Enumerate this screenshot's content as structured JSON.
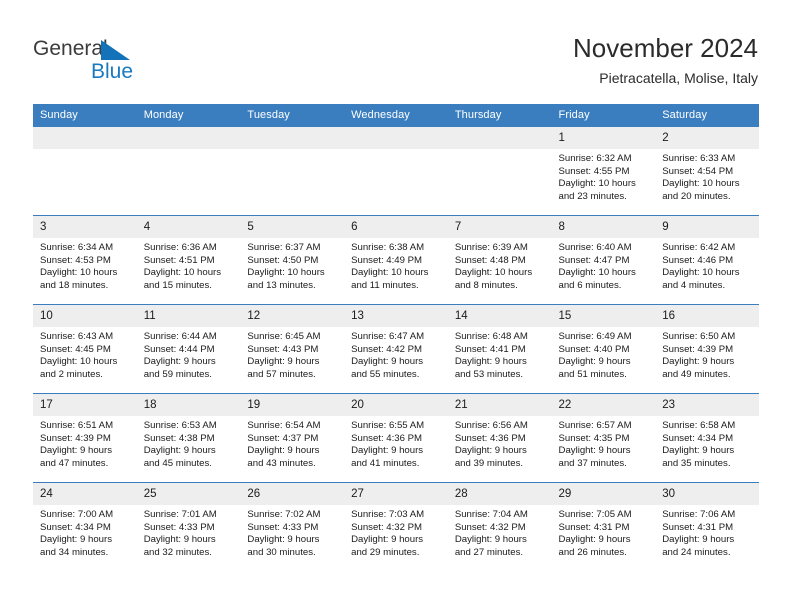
{
  "logo": {
    "primary_text": "General",
    "secondary_text": "Blue",
    "triangle_color": "#1473b8",
    "secondary_color": "#1a7ac0"
  },
  "header": {
    "title": "November 2024",
    "subtitle": "Pietracatella, Molise, Italy"
  },
  "theme": {
    "header_blue": "#3b7ebf",
    "daynum_gray": "#eeeeee",
    "text_color": "#1b1b1b"
  },
  "weekday_headers": [
    "Sunday",
    "Monday",
    "Tuesday",
    "Wednesday",
    "Thursday",
    "Friday",
    "Saturday"
  ],
  "labels": {
    "sunrise_prefix": "Sunrise:",
    "sunset_prefix": "Sunset:",
    "daylight_prefix": "Daylight:"
  },
  "weeks": [
    [
      {
        "day": "",
        "empty": true,
        "sunrise": "",
        "sunset": "",
        "daylight_1": "",
        "daylight_2": ""
      },
      {
        "day": "",
        "empty": true,
        "sunrise": "",
        "sunset": "",
        "daylight_1": "",
        "daylight_2": ""
      },
      {
        "day": "",
        "empty": true,
        "sunrise": "",
        "sunset": "",
        "daylight_1": "",
        "daylight_2": ""
      },
      {
        "day": "",
        "empty": true,
        "sunrise": "",
        "sunset": "",
        "daylight_1": "",
        "daylight_2": ""
      },
      {
        "day": "",
        "empty": true,
        "sunrise": "",
        "sunset": "",
        "daylight_1": "",
        "daylight_2": ""
      },
      {
        "day": "1",
        "empty": false,
        "sunrise": "Sunrise: 6:32 AM",
        "sunset": "Sunset: 4:55 PM",
        "daylight_1": "Daylight: 10 hours",
        "daylight_2": "and 23 minutes."
      },
      {
        "day": "2",
        "empty": false,
        "sunrise": "Sunrise: 6:33 AM",
        "sunset": "Sunset: 4:54 PM",
        "daylight_1": "Daylight: 10 hours",
        "daylight_2": "and 20 minutes."
      }
    ],
    [
      {
        "day": "3",
        "empty": false,
        "sunrise": "Sunrise: 6:34 AM",
        "sunset": "Sunset: 4:53 PM",
        "daylight_1": "Daylight: 10 hours",
        "daylight_2": "and 18 minutes."
      },
      {
        "day": "4",
        "empty": false,
        "sunrise": "Sunrise: 6:36 AM",
        "sunset": "Sunset: 4:51 PM",
        "daylight_1": "Daylight: 10 hours",
        "daylight_2": "and 15 minutes."
      },
      {
        "day": "5",
        "empty": false,
        "sunrise": "Sunrise: 6:37 AM",
        "sunset": "Sunset: 4:50 PM",
        "daylight_1": "Daylight: 10 hours",
        "daylight_2": "and 13 minutes."
      },
      {
        "day": "6",
        "empty": false,
        "sunrise": "Sunrise: 6:38 AM",
        "sunset": "Sunset: 4:49 PM",
        "daylight_1": "Daylight: 10 hours",
        "daylight_2": "and 11 minutes."
      },
      {
        "day": "7",
        "empty": false,
        "sunrise": "Sunrise: 6:39 AM",
        "sunset": "Sunset: 4:48 PM",
        "daylight_1": "Daylight: 10 hours",
        "daylight_2": "and 8 minutes."
      },
      {
        "day": "8",
        "empty": false,
        "sunrise": "Sunrise: 6:40 AM",
        "sunset": "Sunset: 4:47 PM",
        "daylight_1": "Daylight: 10 hours",
        "daylight_2": "and 6 minutes."
      },
      {
        "day": "9",
        "empty": false,
        "sunrise": "Sunrise: 6:42 AM",
        "sunset": "Sunset: 4:46 PM",
        "daylight_1": "Daylight: 10 hours",
        "daylight_2": "and 4 minutes."
      }
    ],
    [
      {
        "day": "10",
        "empty": false,
        "sunrise": "Sunrise: 6:43 AM",
        "sunset": "Sunset: 4:45 PM",
        "daylight_1": "Daylight: 10 hours",
        "daylight_2": "and 2 minutes."
      },
      {
        "day": "11",
        "empty": false,
        "sunrise": "Sunrise: 6:44 AM",
        "sunset": "Sunset: 4:44 PM",
        "daylight_1": "Daylight: 9 hours",
        "daylight_2": "and 59 minutes."
      },
      {
        "day": "12",
        "empty": false,
        "sunrise": "Sunrise: 6:45 AM",
        "sunset": "Sunset: 4:43 PM",
        "daylight_1": "Daylight: 9 hours",
        "daylight_2": "and 57 minutes."
      },
      {
        "day": "13",
        "empty": false,
        "sunrise": "Sunrise: 6:47 AM",
        "sunset": "Sunset: 4:42 PM",
        "daylight_1": "Daylight: 9 hours",
        "daylight_2": "and 55 minutes."
      },
      {
        "day": "14",
        "empty": false,
        "sunrise": "Sunrise: 6:48 AM",
        "sunset": "Sunset: 4:41 PM",
        "daylight_1": "Daylight: 9 hours",
        "daylight_2": "and 53 minutes."
      },
      {
        "day": "15",
        "empty": false,
        "sunrise": "Sunrise: 6:49 AM",
        "sunset": "Sunset: 4:40 PM",
        "daylight_1": "Daylight: 9 hours",
        "daylight_2": "and 51 minutes."
      },
      {
        "day": "16",
        "empty": false,
        "sunrise": "Sunrise: 6:50 AM",
        "sunset": "Sunset: 4:39 PM",
        "daylight_1": "Daylight: 9 hours",
        "daylight_2": "and 49 minutes."
      }
    ],
    [
      {
        "day": "17",
        "empty": false,
        "sunrise": "Sunrise: 6:51 AM",
        "sunset": "Sunset: 4:39 PM",
        "daylight_1": "Daylight: 9 hours",
        "daylight_2": "and 47 minutes."
      },
      {
        "day": "18",
        "empty": false,
        "sunrise": "Sunrise: 6:53 AM",
        "sunset": "Sunset: 4:38 PM",
        "daylight_1": "Daylight: 9 hours",
        "daylight_2": "and 45 minutes."
      },
      {
        "day": "19",
        "empty": false,
        "sunrise": "Sunrise: 6:54 AM",
        "sunset": "Sunset: 4:37 PM",
        "daylight_1": "Daylight: 9 hours",
        "daylight_2": "and 43 minutes."
      },
      {
        "day": "20",
        "empty": false,
        "sunrise": "Sunrise: 6:55 AM",
        "sunset": "Sunset: 4:36 PM",
        "daylight_1": "Daylight: 9 hours",
        "daylight_2": "and 41 minutes."
      },
      {
        "day": "21",
        "empty": false,
        "sunrise": "Sunrise: 6:56 AM",
        "sunset": "Sunset: 4:36 PM",
        "daylight_1": "Daylight: 9 hours",
        "daylight_2": "and 39 minutes."
      },
      {
        "day": "22",
        "empty": false,
        "sunrise": "Sunrise: 6:57 AM",
        "sunset": "Sunset: 4:35 PM",
        "daylight_1": "Daylight: 9 hours",
        "daylight_2": "and 37 minutes."
      },
      {
        "day": "23",
        "empty": false,
        "sunrise": "Sunrise: 6:58 AM",
        "sunset": "Sunset: 4:34 PM",
        "daylight_1": "Daylight: 9 hours",
        "daylight_2": "and 35 minutes."
      }
    ],
    [
      {
        "day": "24",
        "empty": false,
        "sunrise": "Sunrise: 7:00 AM",
        "sunset": "Sunset: 4:34 PM",
        "daylight_1": "Daylight: 9 hours",
        "daylight_2": "and 34 minutes."
      },
      {
        "day": "25",
        "empty": false,
        "sunrise": "Sunrise: 7:01 AM",
        "sunset": "Sunset: 4:33 PM",
        "daylight_1": "Daylight: 9 hours",
        "daylight_2": "and 32 minutes."
      },
      {
        "day": "26",
        "empty": false,
        "sunrise": "Sunrise: 7:02 AM",
        "sunset": "Sunset: 4:33 PM",
        "daylight_1": "Daylight: 9 hours",
        "daylight_2": "and 30 minutes."
      },
      {
        "day": "27",
        "empty": false,
        "sunrise": "Sunrise: 7:03 AM",
        "sunset": "Sunset: 4:32 PM",
        "daylight_1": "Daylight: 9 hours",
        "daylight_2": "and 29 minutes."
      },
      {
        "day": "28",
        "empty": false,
        "sunrise": "Sunrise: 7:04 AM",
        "sunset": "Sunset: 4:32 PM",
        "daylight_1": "Daylight: 9 hours",
        "daylight_2": "and 27 minutes."
      },
      {
        "day": "29",
        "empty": false,
        "sunrise": "Sunrise: 7:05 AM",
        "sunset": "Sunset: 4:31 PM",
        "daylight_1": "Daylight: 9 hours",
        "daylight_2": "and 26 minutes."
      },
      {
        "day": "30",
        "empty": false,
        "sunrise": "Sunrise: 7:06 AM",
        "sunset": "Sunset: 4:31 PM",
        "daylight_1": "Daylight: 9 hours",
        "daylight_2": "and 24 minutes."
      }
    ]
  ]
}
